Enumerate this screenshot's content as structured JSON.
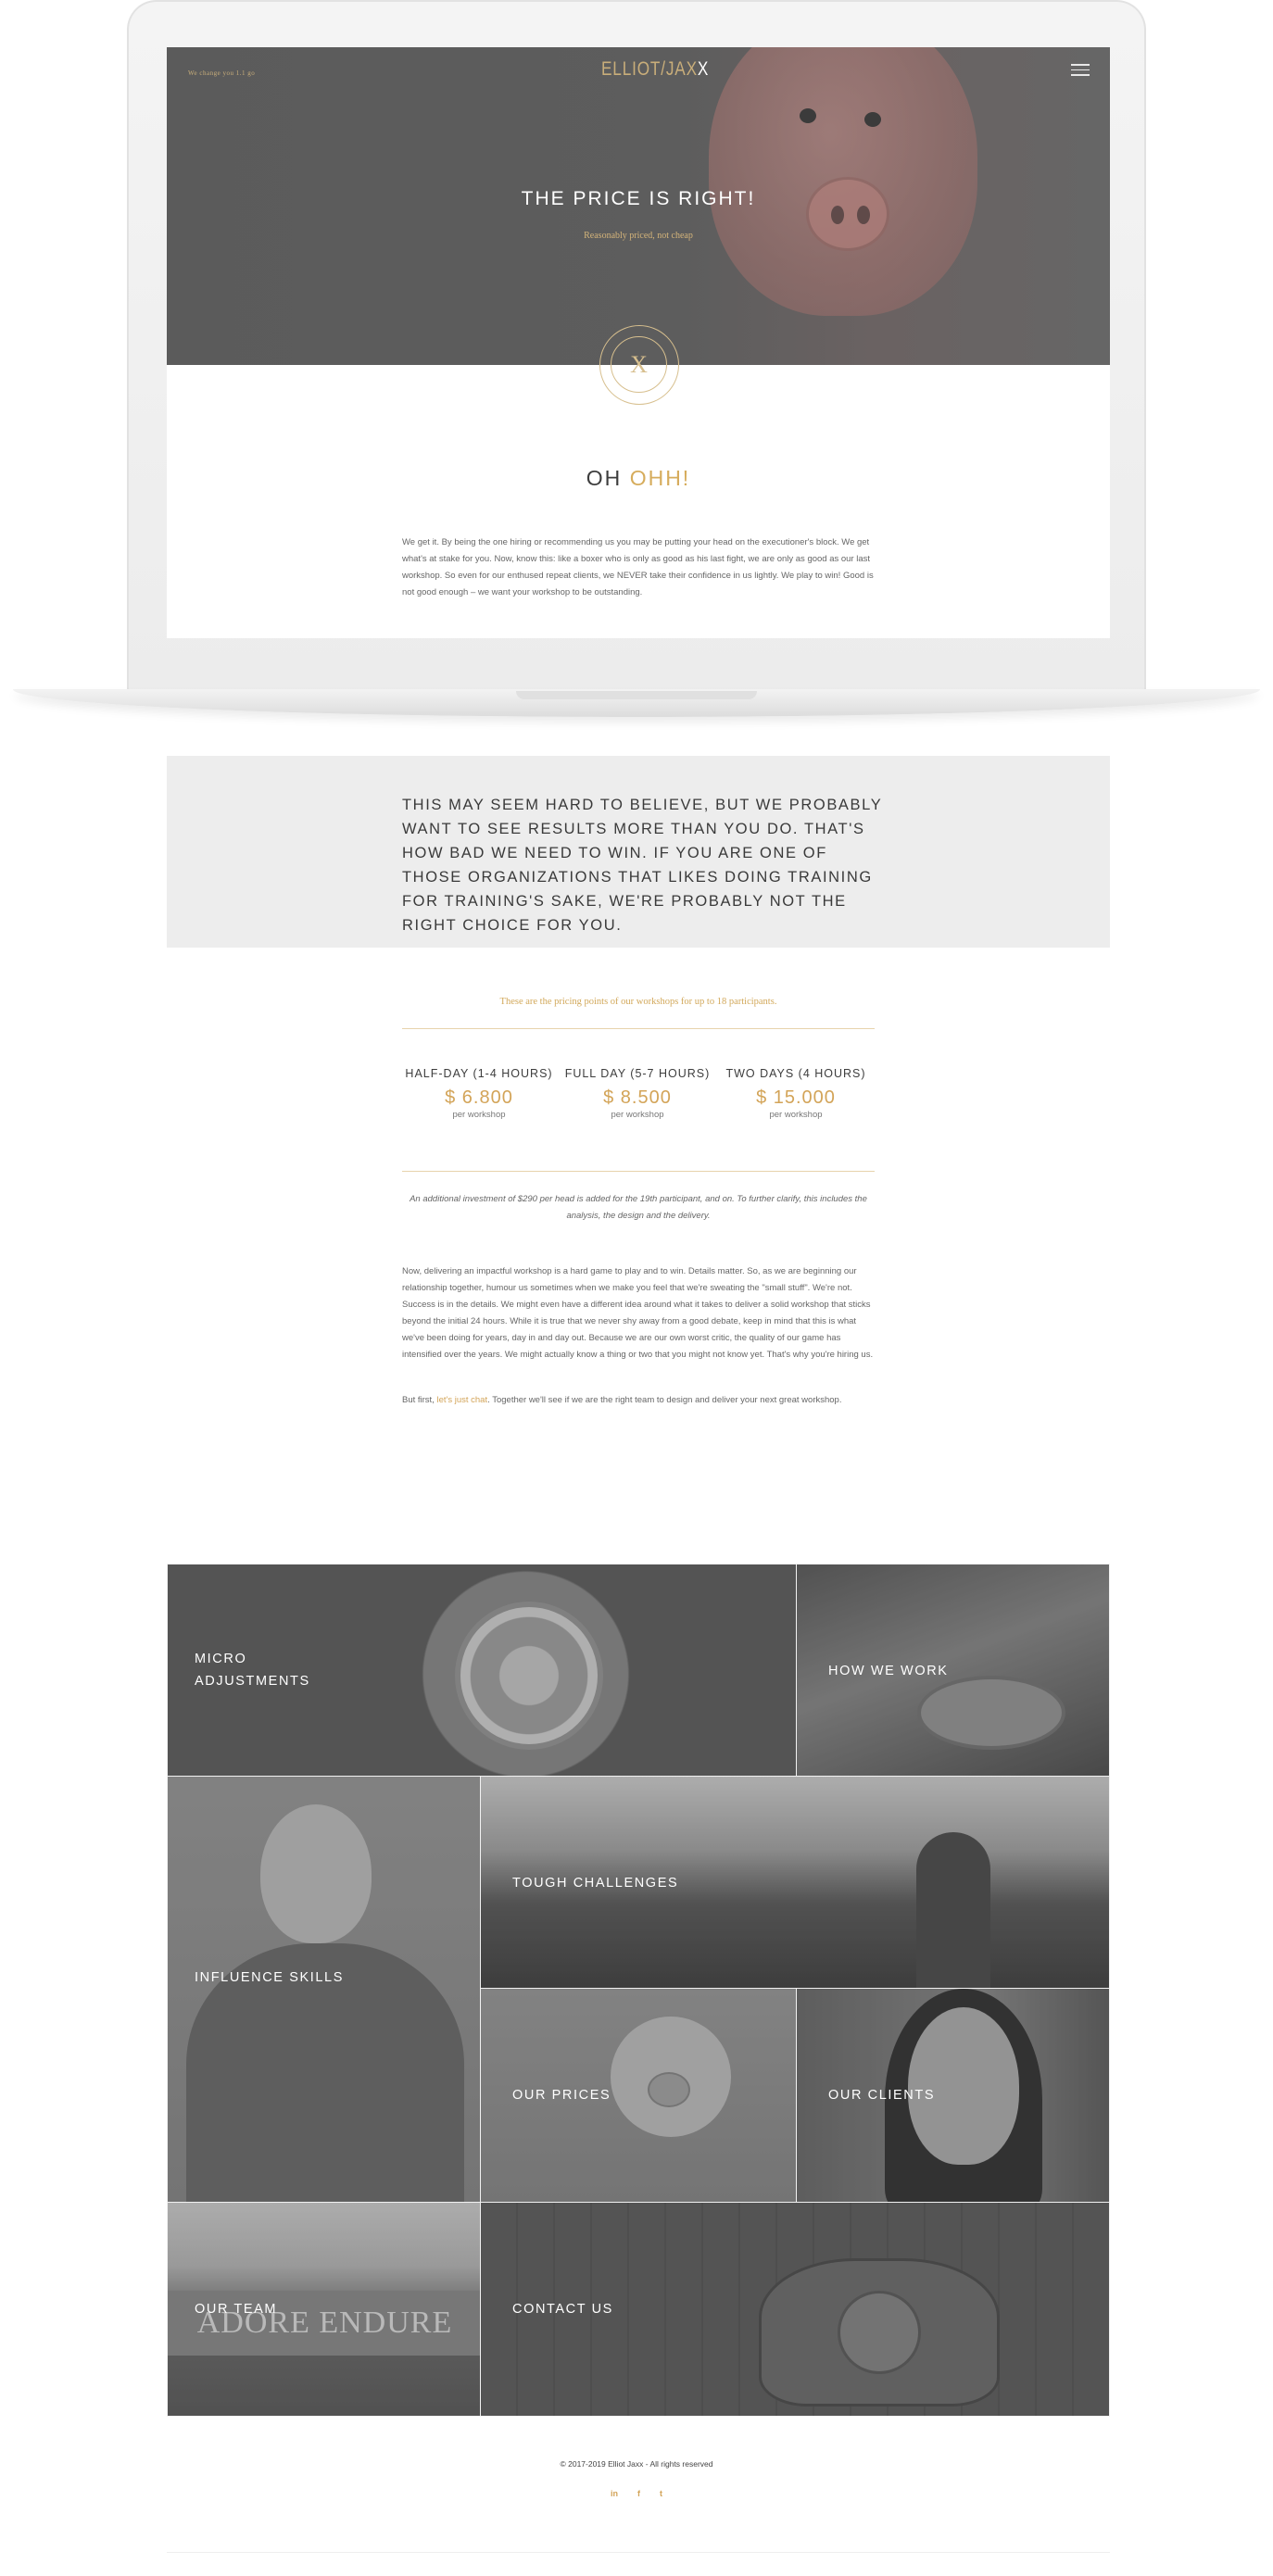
{
  "hero": {
    "small_text": "We change you 1.1 go",
    "logo_main": "ELLIOT/JAX",
    "logo_accent": "X",
    "title": "THE PRICE IS RIGHT!",
    "subtitle": "Reasonably priced, not cheap",
    "seal_glyph": "X"
  },
  "intro": {
    "heading_plain": "OH ",
    "heading_accent": "OHH!",
    "paragraph": "We get it. By being the one hiring or recommending us you may be putting your head on the executioner's block. We get what's at stake for you. Now, know this: like a boxer who is only as good as his last fight, we are only as good as our last workshop. So even for our enthused repeat clients, we NEVER take their confidence in us lightly. We play to win! Good is not good enough – we want your workshop to be outstanding."
  },
  "quote": {
    "text": "This may seem hard to believe, but we probably want to see results more than you do. That's how bad we need to win. If you are one of those organizations that likes doing training for training's sake, we're probably not the right choice for you."
  },
  "pricing": {
    "intro": "These are the pricing points of our workshops for up to 18 participants.",
    "plans": [
      {
        "title": "HALF-DAY (1-4 HOURS)",
        "price": "$ 6.800",
        "per": "per workshop",
        "ghost": "1"
      },
      {
        "title": "FULL DAY (5-7 HOURS)",
        "price": "$ 8.500",
        "per": "per workshop",
        "ghost": "2"
      },
      {
        "title": "TWO DAYS (4 HOURS)",
        "price": "$ 15.000",
        "per": "per workshop",
        "ghost": "3"
      }
    ],
    "note": "An additional investment of $290 per head is added for the 19th participant, and on. To further clarify, this includes the analysis, the design and the delivery."
  },
  "body": {
    "p1": "Now, delivering an impactful workshop is a hard game to play and to win. Details matter. So, as we are beginning our relationship together, humour us sometimes when we make you feel that we're sweating the \"small stuff\". We're not. Success is in the details. We might even have a different idea around what it takes to deliver a solid workshop that sticks beyond the initial 24 hours. While it is true that we never shy away from a good debate, keep in mind that this is what we've been doing for years, day in and day out. Because we are our own worst critic, the quality of our game has intensified over the years. We might actually know a thing or two that you might not know yet. That's why you're hiring us.",
    "p2_before": "But first, ",
    "p2_link": "let's just chat",
    "p2_after": ". Together we'll see if we are the right team to design and deliver your next great workshop."
  },
  "tiles": {
    "micro": "MICRO\nADJUSTMENTS",
    "how": "HOW WE WORK",
    "influence": "INFLUENCE SKILLS",
    "tough": "TOUGH CHALLENGES",
    "prices": "OUR PRICES",
    "clients": "OUR CLIENTS",
    "team": "OUR TEAM",
    "team_sign": "ADORE ENDURE",
    "contact": "CONTACT US"
  },
  "footer": {
    "copyright": "© 2017-2019 Elliot Jaxx - All rights reserved",
    "social_linkedin": "in",
    "social_facebook": "f",
    "social_twitter": "t"
  },
  "colors": {
    "accent": "#d3a458",
    "band": "#ededed"
  }
}
